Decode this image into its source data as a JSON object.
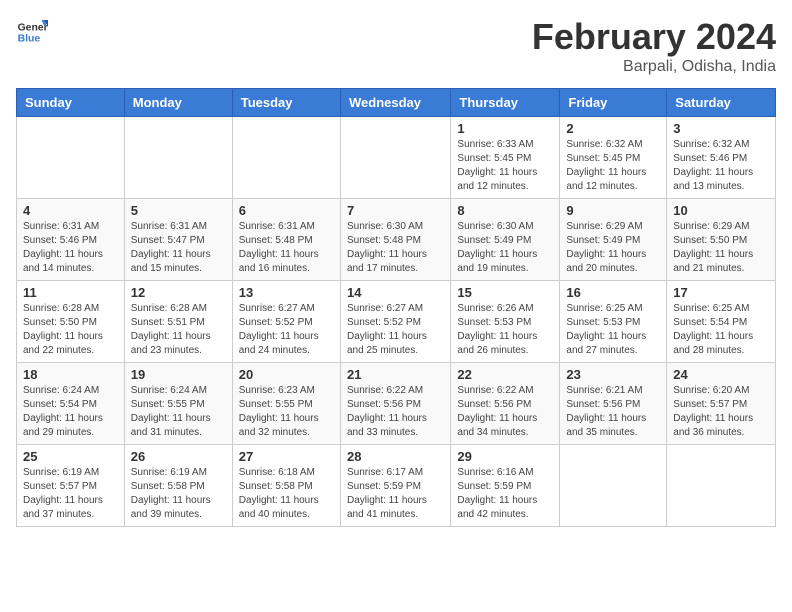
{
  "header": {
    "logo_general": "General",
    "logo_blue": "Blue",
    "month_year": "February 2024",
    "location": "Barpali, Odisha, India"
  },
  "days_of_week": [
    "Sunday",
    "Monday",
    "Tuesday",
    "Wednesday",
    "Thursday",
    "Friday",
    "Saturday"
  ],
  "weeks": [
    [
      {
        "day": "",
        "info": ""
      },
      {
        "day": "",
        "info": ""
      },
      {
        "day": "",
        "info": ""
      },
      {
        "day": "",
        "info": ""
      },
      {
        "day": "1",
        "info": "Sunrise: 6:33 AM\nSunset: 5:45 PM\nDaylight: 11 hours\nand 12 minutes."
      },
      {
        "day": "2",
        "info": "Sunrise: 6:32 AM\nSunset: 5:45 PM\nDaylight: 11 hours\nand 12 minutes."
      },
      {
        "day": "3",
        "info": "Sunrise: 6:32 AM\nSunset: 5:46 PM\nDaylight: 11 hours\nand 13 minutes."
      }
    ],
    [
      {
        "day": "4",
        "info": "Sunrise: 6:31 AM\nSunset: 5:46 PM\nDaylight: 11 hours\nand 14 minutes."
      },
      {
        "day": "5",
        "info": "Sunrise: 6:31 AM\nSunset: 5:47 PM\nDaylight: 11 hours\nand 15 minutes."
      },
      {
        "day": "6",
        "info": "Sunrise: 6:31 AM\nSunset: 5:48 PM\nDaylight: 11 hours\nand 16 minutes."
      },
      {
        "day": "7",
        "info": "Sunrise: 6:30 AM\nSunset: 5:48 PM\nDaylight: 11 hours\nand 17 minutes."
      },
      {
        "day": "8",
        "info": "Sunrise: 6:30 AM\nSunset: 5:49 PM\nDaylight: 11 hours\nand 19 minutes."
      },
      {
        "day": "9",
        "info": "Sunrise: 6:29 AM\nSunset: 5:49 PM\nDaylight: 11 hours\nand 20 minutes."
      },
      {
        "day": "10",
        "info": "Sunrise: 6:29 AM\nSunset: 5:50 PM\nDaylight: 11 hours\nand 21 minutes."
      }
    ],
    [
      {
        "day": "11",
        "info": "Sunrise: 6:28 AM\nSunset: 5:50 PM\nDaylight: 11 hours\nand 22 minutes."
      },
      {
        "day": "12",
        "info": "Sunrise: 6:28 AM\nSunset: 5:51 PM\nDaylight: 11 hours\nand 23 minutes."
      },
      {
        "day": "13",
        "info": "Sunrise: 6:27 AM\nSunset: 5:52 PM\nDaylight: 11 hours\nand 24 minutes."
      },
      {
        "day": "14",
        "info": "Sunrise: 6:27 AM\nSunset: 5:52 PM\nDaylight: 11 hours\nand 25 minutes."
      },
      {
        "day": "15",
        "info": "Sunrise: 6:26 AM\nSunset: 5:53 PM\nDaylight: 11 hours\nand 26 minutes."
      },
      {
        "day": "16",
        "info": "Sunrise: 6:25 AM\nSunset: 5:53 PM\nDaylight: 11 hours\nand 27 minutes."
      },
      {
        "day": "17",
        "info": "Sunrise: 6:25 AM\nSunset: 5:54 PM\nDaylight: 11 hours\nand 28 minutes."
      }
    ],
    [
      {
        "day": "18",
        "info": "Sunrise: 6:24 AM\nSunset: 5:54 PM\nDaylight: 11 hours\nand 29 minutes."
      },
      {
        "day": "19",
        "info": "Sunrise: 6:24 AM\nSunset: 5:55 PM\nDaylight: 11 hours\nand 31 minutes."
      },
      {
        "day": "20",
        "info": "Sunrise: 6:23 AM\nSunset: 5:55 PM\nDaylight: 11 hours\nand 32 minutes."
      },
      {
        "day": "21",
        "info": "Sunrise: 6:22 AM\nSunset: 5:56 PM\nDaylight: 11 hours\nand 33 minutes."
      },
      {
        "day": "22",
        "info": "Sunrise: 6:22 AM\nSunset: 5:56 PM\nDaylight: 11 hours\nand 34 minutes."
      },
      {
        "day": "23",
        "info": "Sunrise: 6:21 AM\nSunset: 5:56 PM\nDaylight: 11 hours\nand 35 minutes."
      },
      {
        "day": "24",
        "info": "Sunrise: 6:20 AM\nSunset: 5:57 PM\nDaylight: 11 hours\nand 36 minutes."
      }
    ],
    [
      {
        "day": "25",
        "info": "Sunrise: 6:19 AM\nSunset: 5:57 PM\nDaylight: 11 hours\nand 37 minutes."
      },
      {
        "day": "26",
        "info": "Sunrise: 6:19 AM\nSunset: 5:58 PM\nDaylight: 11 hours\nand 39 minutes."
      },
      {
        "day": "27",
        "info": "Sunrise: 6:18 AM\nSunset: 5:58 PM\nDaylight: 11 hours\nand 40 minutes."
      },
      {
        "day": "28",
        "info": "Sunrise: 6:17 AM\nSunset: 5:59 PM\nDaylight: 11 hours\nand 41 minutes."
      },
      {
        "day": "29",
        "info": "Sunrise: 6:16 AM\nSunset: 5:59 PM\nDaylight: 11 hours\nand 42 minutes."
      },
      {
        "day": "",
        "info": ""
      },
      {
        "day": "",
        "info": ""
      }
    ]
  ]
}
